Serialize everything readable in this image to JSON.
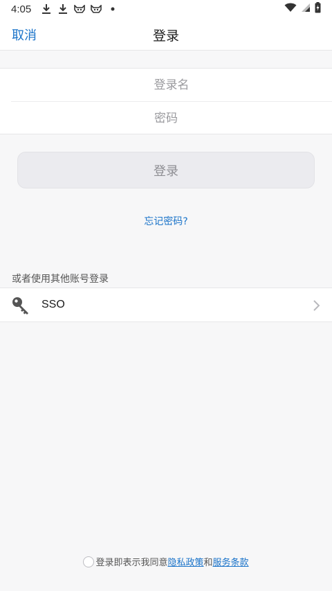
{
  "statusbar": {
    "time": "4:05"
  },
  "navbar": {
    "cancel_label": "取消",
    "title": "登录"
  },
  "form": {
    "username_placeholder": "登录名",
    "password_placeholder": "密码"
  },
  "login_button": {
    "label": "登录"
  },
  "forgot_password": {
    "label": "忘记密码?"
  },
  "other_login": {
    "section_label": "或者使用其他账号登录",
    "providers": [
      {
        "label": "SSO",
        "icon": "key-icon"
      }
    ]
  },
  "agreement": {
    "prefix": "登录即表示我同意",
    "privacy_link": "隐私政策",
    "and_text": "和",
    "terms_link": "服务条款"
  },
  "colors": {
    "accent": "#1a73c9",
    "background": "#f7f7f8"
  }
}
